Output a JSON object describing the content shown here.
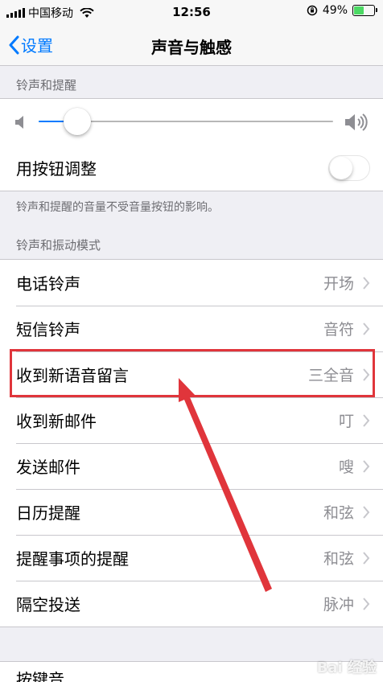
{
  "status_bar": {
    "carrier": "中国移动",
    "time": "12:56",
    "battery_percent": "49%",
    "battery_level": 0.49
  },
  "nav": {
    "back_label": "设置",
    "title": "声音与触感"
  },
  "ringer_section": {
    "header": "铃声和提醒",
    "volume_level": 0.13,
    "toggle_label": "用按钮调整",
    "toggle_on": false,
    "footer": "铃声和提醒的音量不受音量按钮的影响。"
  },
  "patterns_section": {
    "header": "铃声和振动模式",
    "items": [
      {
        "label": "电话铃声",
        "value": "开场"
      },
      {
        "label": "短信铃声",
        "value": "音符"
      },
      {
        "label": "收到新语音留言",
        "value": "三全音"
      },
      {
        "label": "收到新邮件",
        "value": "叮"
      },
      {
        "label": "发送邮件",
        "value": "嗖"
      },
      {
        "label": "日历提醒",
        "value": "和弦"
      },
      {
        "label": "提醒事项的提醒",
        "value": "和弦"
      },
      {
        "label": "隔空投送",
        "value": "脉冲"
      }
    ]
  },
  "partial_item": {
    "label": "按键音"
  },
  "watermark": "Bai 经验",
  "colors": {
    "accent": "#007aff",
    "highlight_box": "#e0353b",
    "arrow": "#e0353b",
    "battery": "#4cd964"
  }
}
